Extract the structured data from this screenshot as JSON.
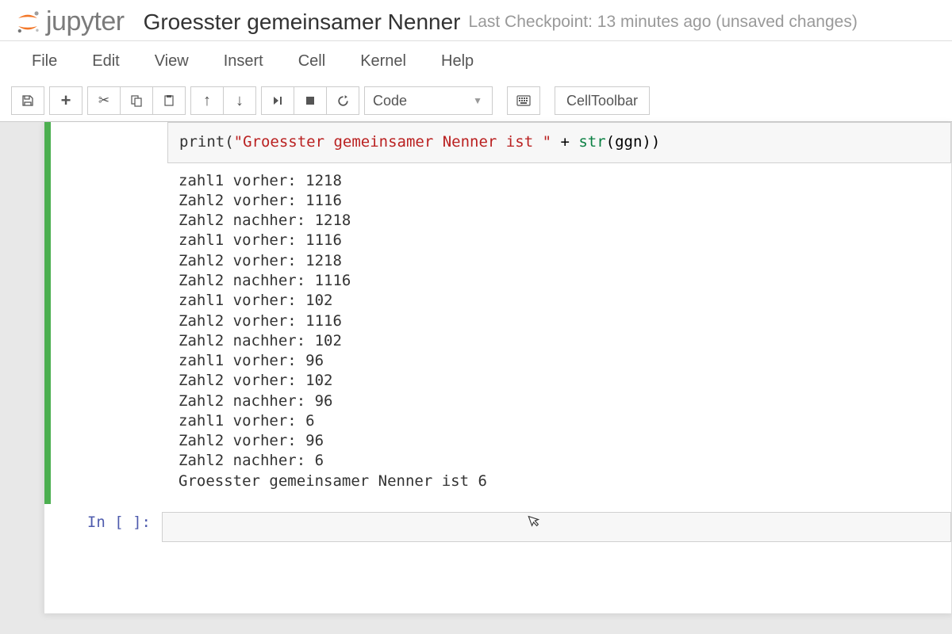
{
  "header": {
    "logo_text": "jupyter",
    "notebook_title": "Groesster gemeinsamer Nenner",
    "checkpoint": "Last Checkpoint: 13 minutes ago (unsaved changes)"
  },
  "menu": {
    "items": [
      "File",
      "Edit",
      "View",
      "Insert",
      "Cell",
      "Kernel",
      "Help"
    ]
  },
  "toolbar": {
    "cell_type": "Code",
    "cell_toolbar_label": "CellToolbar"
  },
  "code_cell": {
    "prefix": "print(",
    "string": "\"Groesster gemeinsamer Nenner ist \"",
    "plus": " + ",
    "strcall": "str",
    "openparen": "(ggn))"
  },
  "output_lines": [
    "zahl1 vorher: 1218",
    "Zahl2 vorher: 1116",
    "Zahl2 nachher: 1218",
    "zahl1 vorher: 1116",
    "Zahl2 vorher: 1218",
    "Zahl2 nachher: 1116",
    "zahl1 vorher: 102",
    "Zahl2 vorher: 1116",
    "Zahl2 nachher: 102",
    "zahl1 vorher: 96",
    "Zahl2 vorher: 102",
    "Zahl2 nachher: 96",
    "zahl1 vorher: 6",
    "Zahl2 vorher: 96",
    "Zahl2 nachher: 6",
    "Groesster gemeinsamer Nenner ist 6"
  ],
  "empty_cell": {
    "prompt": "In [ ]:"
  }
}
